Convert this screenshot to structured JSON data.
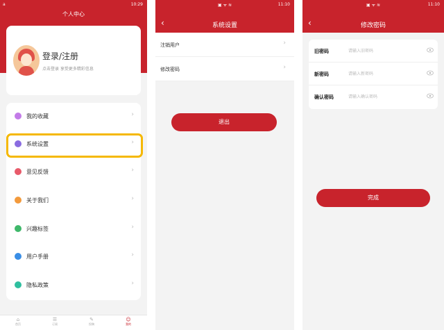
{
  "screen1": {
    "status": {
      "left": "a",
      "right": "10:29"
    },
    "title": "个人中心",
    "login": {
      "title": "登录/注册",
      "subtitle": "点击登录 享受更多精彩信息"
    },
    "menu": [
      {
        "label": "我的收藏",
        "color": "#c37be8",
        "icon": "star-icon"
      },
      {
        "label": "系统设置",
        "color": "#8a6ce0",
        "icon": "gear-icon"
      },
      {
        "label": "意见反馈",
        "color": "#e85a6a",
        "icon": "feedback-icon"
      },
      {
        "label": "关于我们",
        "color": "#f39a3c",
        "icon": "info-icon"
      },
      {
        "label": "兴趣标签",
        "color": "#3fb86a",
        "icon": "tag-icon"
      },
      {
        "label": "用户手册",
        "color": "#3a8ee6",
        "icon": "book-icon"
      },
      {
        "label": "隐私政策",
        "color": "#2fbf9f",
        "icon": "shield-icon"
      }
    ],
    "chevron": "›",
    "tabs": [
      {
        "label": "首页",
        "icon": "⌂"
      },
      {
        "label": "订阅",
        "icon": "☰"
      },
      {
        "label": "投稿",
        "icon": "✎"
      },
      {
        "label": "我的",
        "icon": "☺"
      }
    ]
  },
  "screen2": {
    "status": {
      "center": "▣ ᯤ ≋",
      "right": "11:10"
    },
    "title": "系统设置",
    "back": "‹",
    "items": [
      "注销用户",
      "修改密码"
    ],
    "chevron": "›",
    "logout": "退出"
  },
  "screen3": {
    "status": {
      "center": "▣ ᯤ ≋",
      "right": "11:10"
    },
    "title": "修改密码",
    "back": "‹",
    "fields": [
      {
        "label": "旧密码",
        "placeholder": "请输入旧密码"
      },
      {
        "label": "新密码",
        "placeholder": "请输入新密码"
      },
      {
        "label": "确认密码",
        "placeholder": "请输入确认密码"
      }
    ],
    "done": "完成"
  },
  "colors": {
    "primary": "#c8232c",
    "highlight": "#f5b800",
    "background": "#f3f3f3"
  }
}
